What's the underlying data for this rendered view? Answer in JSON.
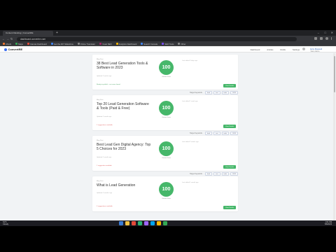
{
  "browser": {
    "tab_title": "Content Ranking | ConvertRE",
    "url": "dashboard.convertre.com",
    "bookmarks": [
      {
        "label": "Ahrefs",
        "color": "#ff7a2f"
      },
      {
        "label": "Maps",
        "color": "#34a853"
      },
      {
        "label": "Canvas Dashboard",
        "color": "#e44b3a"
      },
      {
        "label": "Get the API Slideshow",
        "color": "#4285f4"
      },
      {
        "label": "Online Translator",
        "color": "#888888"
      },
      {
        "label": "Yoast SEO",
        "color": "#a4286a"
      },
      {
        "label": "Analytics Dashboard",
        "color": "#f4b400"
      },
      {
        "label": "Search Console",
        "color": "#4285f4"
      },
      {
        "label": "SEO Tools",
        "color": "#7c4dff"
      },
      {
        "label": "Other",
        "color": "#888888"
      }
    ]
  },
  "header": {
    "logo": "ConvertRE",
    "nav": [
      "Dashboard",
      "Articles",
      "Drafts",
      "Settings"
    ],
    "user_name": "Ezra Maxwell",
    "user_sub": "Team Admin"
  },
  "filters": {
    "label": "Target Keywords",
    "chips": [
      "lead",
      "seo",
      "tools",
      "2023"
    ]
  },
  "cards": [
    {
      "kind": "Blog Post",
      "title": "38 Best Lead Generation Tools & Software in 2023",
      "meta": "Updated 2 weeks ago",
      "score": "100",
      "score_label": "Content Score",
      "note": "Ready to publish · no issues found",
      "note_ok": true,
      "right_text": "Last edited 3 days ago",
      "action": "View Details",
      "show_filters": false
    },
    {
      "kind": "Blog Post",
      "title": "Top 20 Lead Generation Software & Tools (Paid & Free)",
      "meta": "Updated 1 month ago",
      "score": "100",
      "score_label": "Content Score",
      "note": "2 suggestions available",
      "note_ok": false,
      "right_text": "Last edited 1 week ago",
      "action": "View Details",
      "show_filters": true
    },
    {
      "kind": "Blog Post",
      "title": "Best Lead Gen Digital Agency: Top 5 Choices for 2023",
      "meta": "Updated 1 month ago",
      "score": "100",
      "score_label": "Content Score",
      "note": "1 suggestion available",
      "note_ok": false,
      "right_text": "Last edited 2 weeks ago",
      "action": "View Details",
      "show_filters": true
    },
    {
      "kind": "Blog Post",
      "title": "What is Lead Generation",
      "meta": "Updated 2 months ago",
      "score": "100",
      "score_label": "Content Score",
      "note": "3 suggestions available",
      "note_ok": false,
      "right_text": "Last edited 1 month ago",
      "action": "View Details",
      "show_filters": true
    }
  ],
  "taskbar": {
    "weather": "54°F",
    "weather_sub": "Cloudy",
    "time": "1:04 PM",
    "date": "5/8/2023",
    "icon_colors": [
      "#3a7bd5",
      "#f0c040",
      "#e44b3a",
      "#2bb673",
      "#a066ff",
      "#00a4ef",
      "#ffb900",
      "#34a853"
    ]
  }
}
